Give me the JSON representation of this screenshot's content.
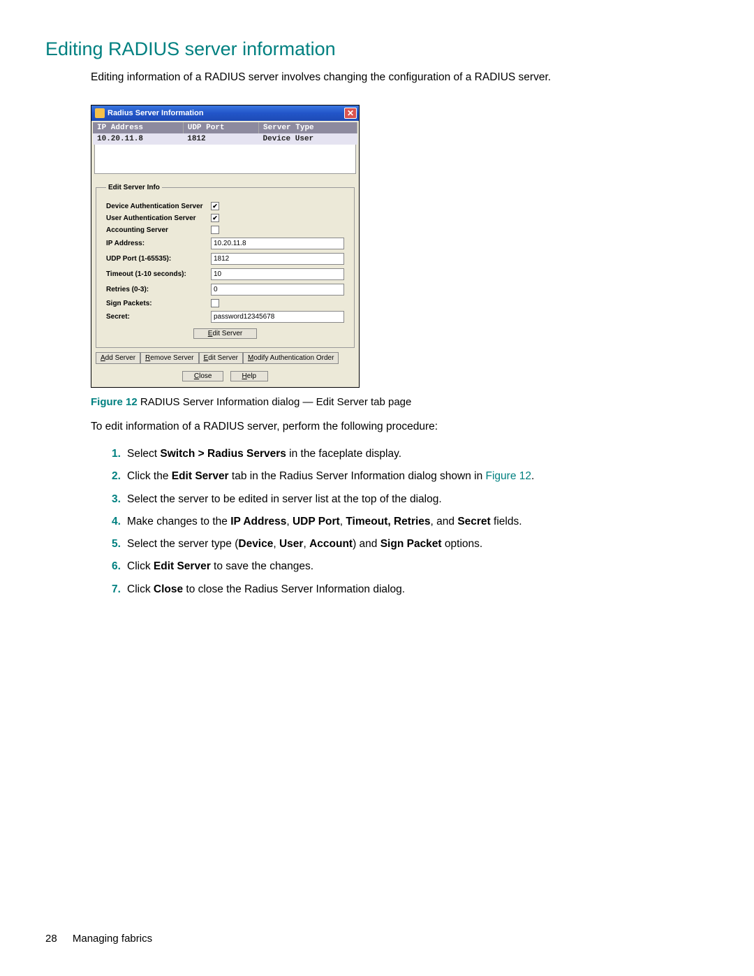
{
  "heading": "Editing RADIUS server information",
  "intro": "Editing information of a RADIUS server involves changing the configuration of a RADIUS server.",
  "dialog": {
    "title": "Radius Server Information",
    "close_glyph": "✕",
    "columns": {
      "c1": "IP Address",
      "c2": "UDP Port",
      "c3": "Server Type"
    },
    "row": {
      "ip": "10.20.11.8",
      "port": "1812",
      "type": "Device User"
    },
    "legend": "Edit Server Info",
    "labels": {
      "dev_auth": "Device Authentication Server",
      "user_auth": "User Authentication Server",
      "acct": "Accounting Server",
      "ip": "IP Address:",
      "udp": "UDP Port (1-65535):",
      "timeout": "Timeout (1-10 seconds):",
      "retries": "Retries (0-3):",
      "sign": "Sign Packets:",
      "secret": "Secret:"
    },
    "values": {
      "dev_auth_checked": "✔",
      "user_auth_checked": "✔",
      "acct_checked": "",
      "ip": "10.20.11.8",
      "udp": "1812",
      "timeout": "10",
      "retries": "0",
      "sign_checked": "",
      "secret": "password12345678"
    },
    "buttons": {
      "edit_server_center": "Edit Server",
      "add": "Add Server",
      "remove": "Remove Server",
      "edit": "Edit Server",
      "modify": "Modify Authentication Order",
      "close": "Close",
      "help": "Help"
    }
  },
  "caption": {
    "label": "Figure 12",
    "text": " RADIUS Server Information dialog — Edit Server tab page"
  },
  "para2": "To edit information of a RADIUS server, perform the following procedure:",
  "steps": {
    "s1a": "Select ",
    "s1b": "Switch > Radius Servers",
    "s1c": " in the faceplate display.",
    "s2a": "Click the ",
    "s2b": "Edit Server",
    "s2c": " tab in the Radius Server Information dialog shown in ",
    "s2d": "Figure 12",
    "s2e": ".",
    "s3": "Select the server to be edited in server list at the top of the dialog.",
    "s4a": "Make changes to the ",
    "s4b": "IP Address",
    "s4c": ", ",
    "s4d": "UDP Port",
    "s4e": ", ",
    "s4f": "Timeout, Retries",
    "s4g": ", and ",
    "s4h": "Secret",
    "s4i": " fields.",
    "s5a": "Select the server type (",
    "s5b": "Device",
    "s5c": ", ",
    "s5d": "User",
    "s5e": ", ",
    "s5f": "Account",
    "s5g": ") and ",
    "s5h": "Sign Packet",
    "s5i": " options.",
    "s6a": "Click ",
    "s6b": "Edit Server",
    "s6c": " to save the changes.",
    "s7a": "Click ",
    "s7b": "Close",
    "s7c": " to close the Radius Server Information dialog."
  },
  "footer": {
    "page": "28",
    "section": "Managing fabrics"
  }
}
